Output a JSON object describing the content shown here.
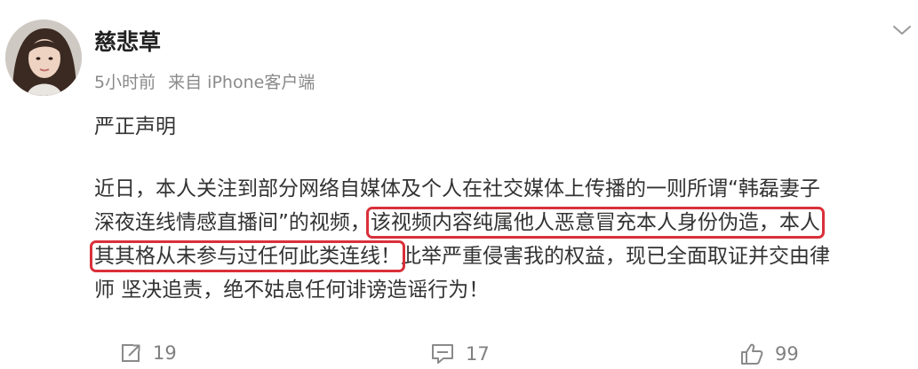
{
  "post": {
    "username": "慈悲草",
    "time": "5小时前",
    "source": "来自 iPhone客户端",
    "heading": "严正声明",
    "body": {
      "line1": "近日，本人关注到部分网络自媒体及个人在社交媒体上传播的一则所谓“韩磊妻子",
      "line2_a": "深夜连线情感直播间”的视频，",
      "line2_b": "该视频内容纯属他人恶意冒充本人身份伪造，本人",
      "line3_a": "其其格从未参与过任何此类连线！",
      "line3_b": "此举严重侵害我的权益，现已全面取证并交由律",
      "line4": "师 坚决追责，绝不姑息任何诽谤造谣行为！"
    }
  },
  "actions": {
    "repost_count": "19",
    "comment_count": "17",
    "like_count": "99"
  },
  "colors": {
    "highlight_border": "#d9303a",
    "meta_text": "#8a8a8a",
    "body_text": "#333333"
  },
  "icons": [
    "chevron-down-icon",
    "repost-icon",
    "comment-icon",
    "like-icon"
  ]
}
